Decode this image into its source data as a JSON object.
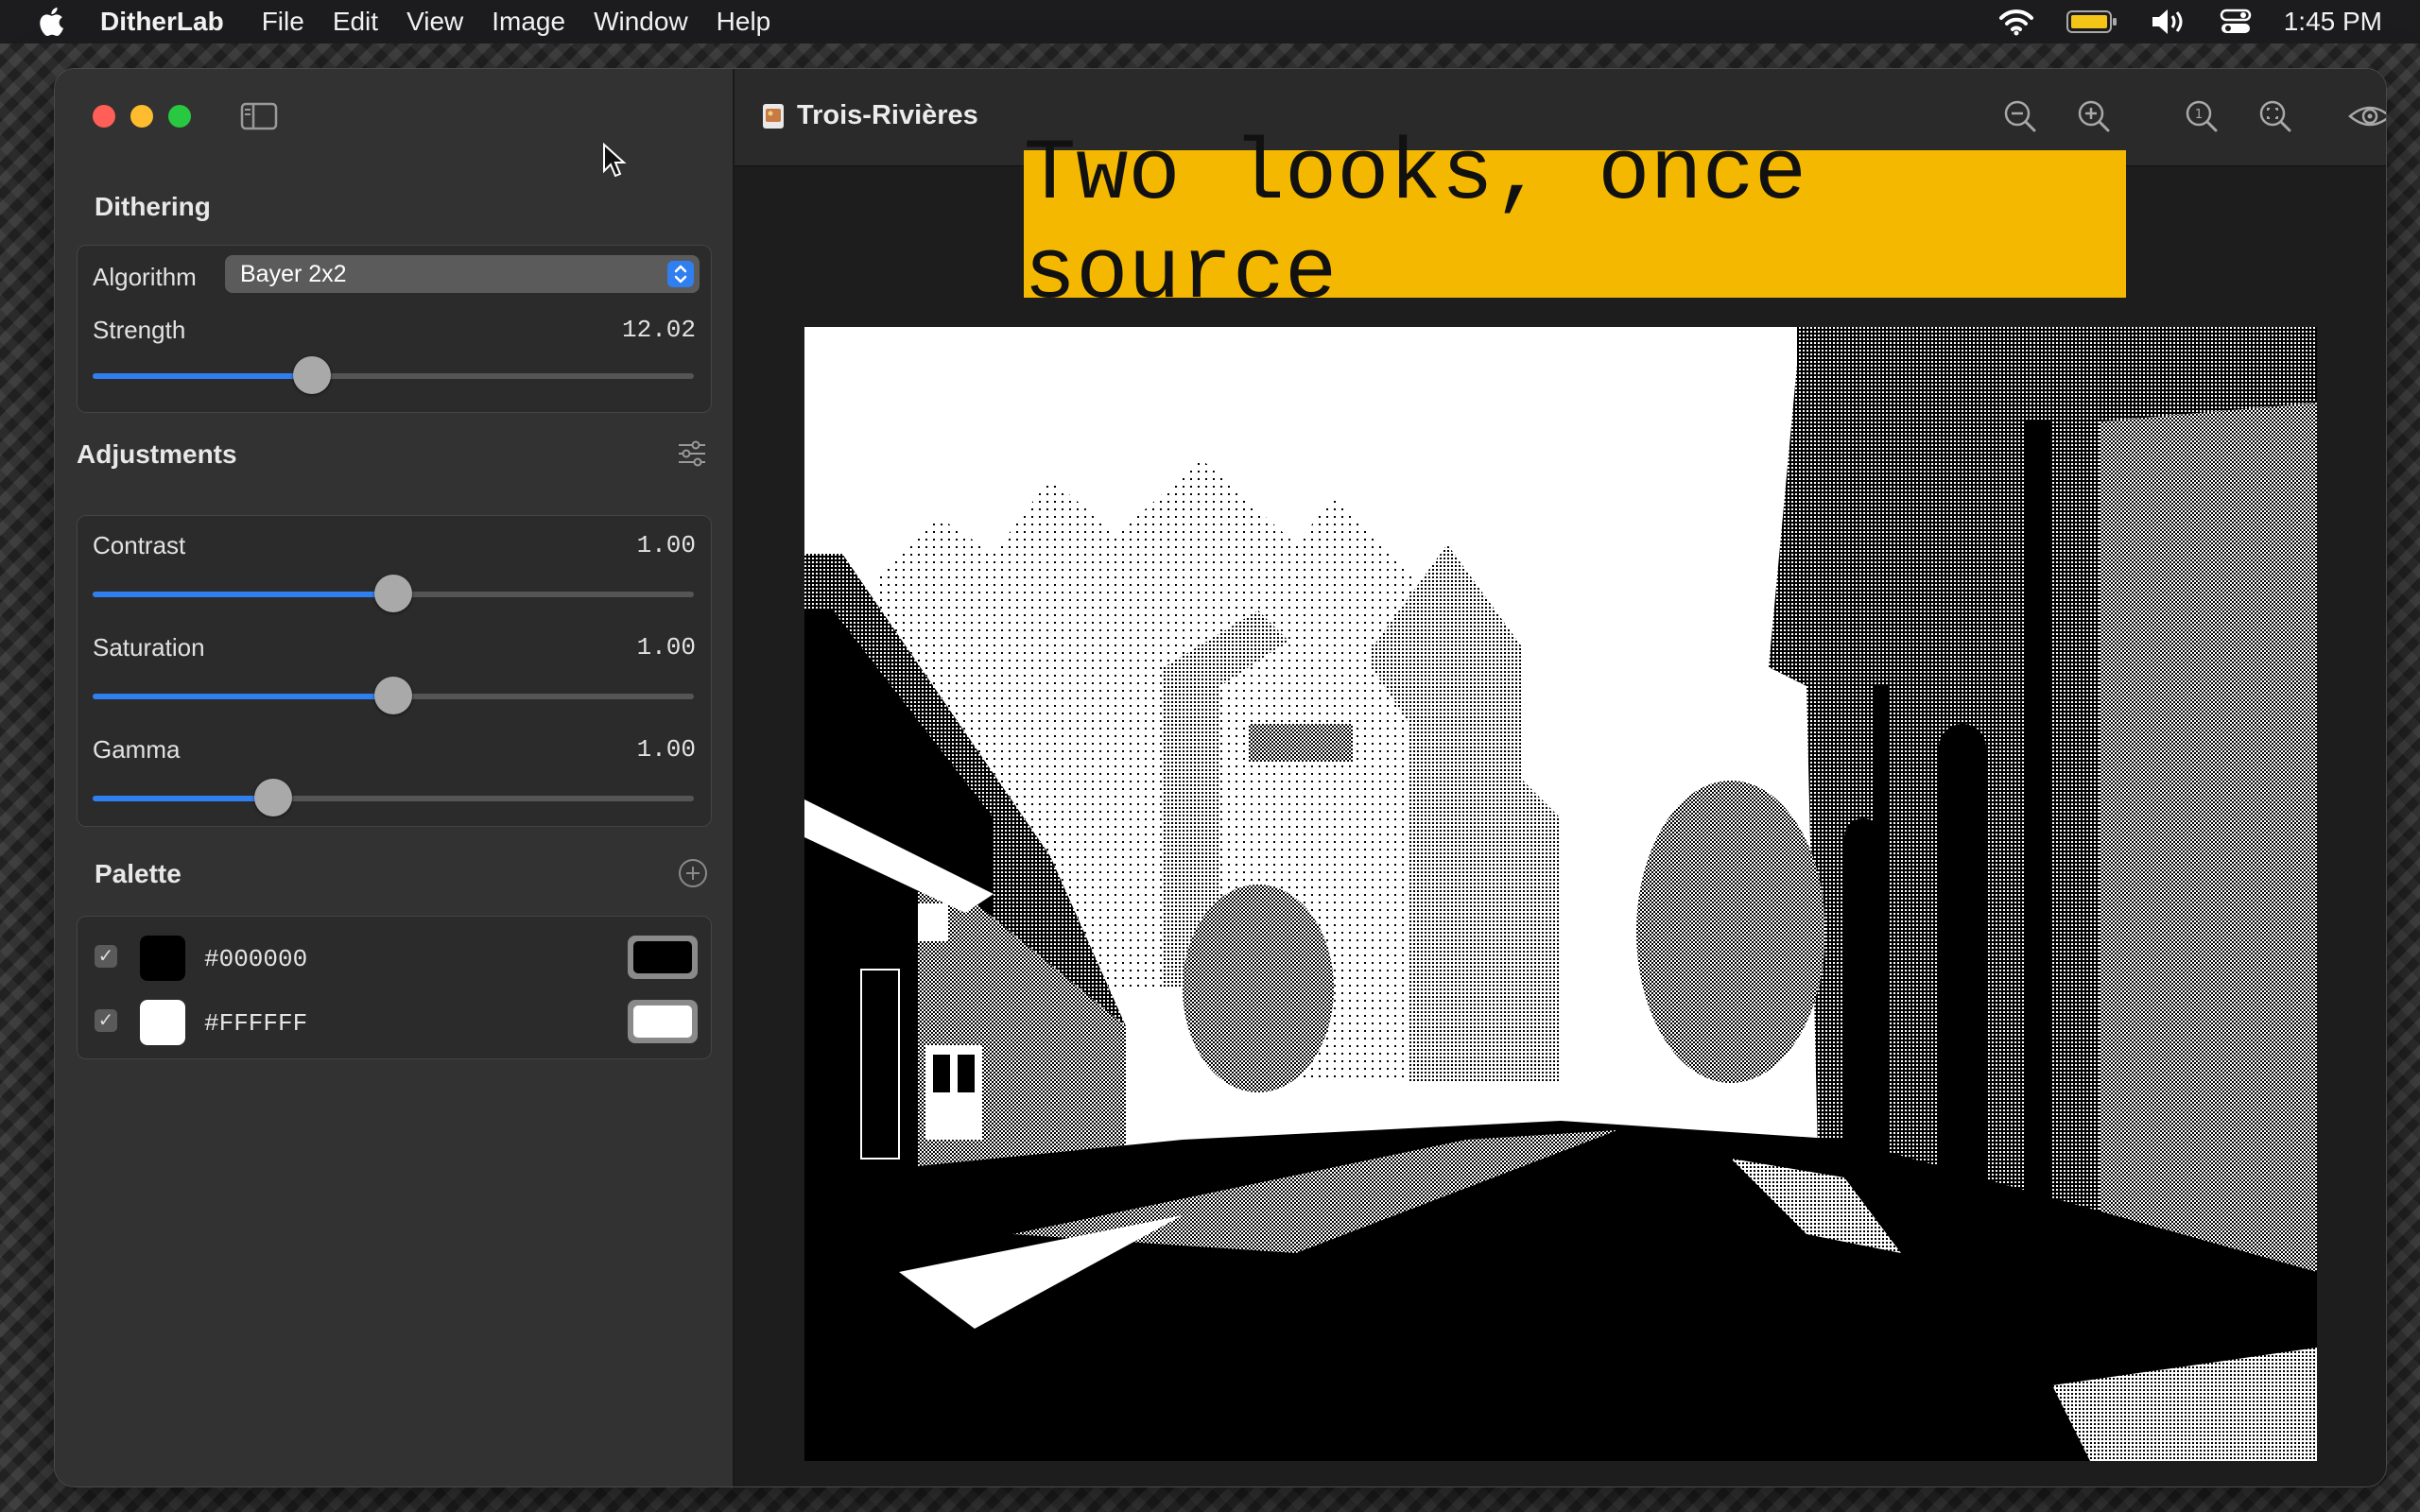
{
  "menubar": {
    "app_name": "DitherLab",
    "items": [
      "File",
      "Edit",
      "View",
      "Image",
      "Window",
      "Help"
    ],
    "clock": "1:45 PM"
  },
  "sidebar": {
    "dithering": {
      "title": "Dithering",
      "algorithm_label": "Algorithm",
      "algorithm_value": "Bayer 2x2",
      "strength_label": "Strength",
      "strength_value": "12.02",
      "strength_level": 0.365
    },
    "adjustments": {
      "title": "Adjustments",
      "contrast_label": "Contrast",
      "contrast_value": "1.00",
      "contrast_level": 0.5,
      "saturation_label": "Saturation",
      "saturation_value": "1.00",
      "saturation_level": 0.5,
      "gamma_label": "Gamma",
      "gamma_value": "1.00",
      "gamma_level": 0.3
    },
    "palette": {
      "title": "Palette",
      "colors": [
        {
          "hex": "#000000",
          "checked": true
        },
        {
          "hex": "#FFFFFF",
          "checked": true
        }
      ]
    }
  },
  "document": {
    "title": "Trois-Rivières"
  },
  "banner": {
    "text": "Two looks, once source"
  },
  "colors": {
    "accent": "#2f7ff0",
    "banner": "#f5b800"
  }
}
